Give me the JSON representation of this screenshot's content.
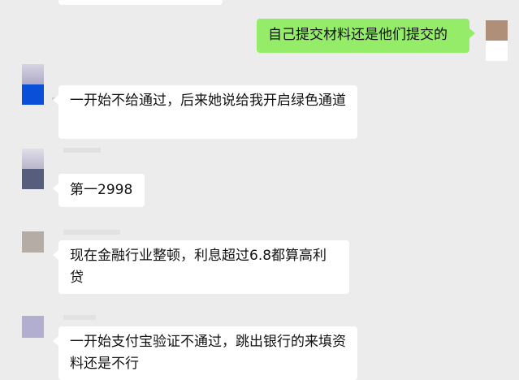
{
  "messages": [
    {
      "direction": "out",
      "text": "自己提交材料还是他们提交的"
    },
    {
      "direction": "in",
      "text": "一开始不给通过，后来她说给我开启绿色通道"
    },
    {
      "direction": "in",
      "text": "第一2998"
    },
    {
      "direction": "in",
      "text": "现在金融行业整顿，利息超过6.8都算高利贷"
    },
    {
      "direction": "in",
      "text": "一开始支付宝验证不通过，跳出银行的来填资料还是不行"
    }
  ],
  "colors": {
    "background": "#ececec",
    "incoming_bubble": "#ffffff",
    "outgoing_bubble": "#95ec69"
  }
}
